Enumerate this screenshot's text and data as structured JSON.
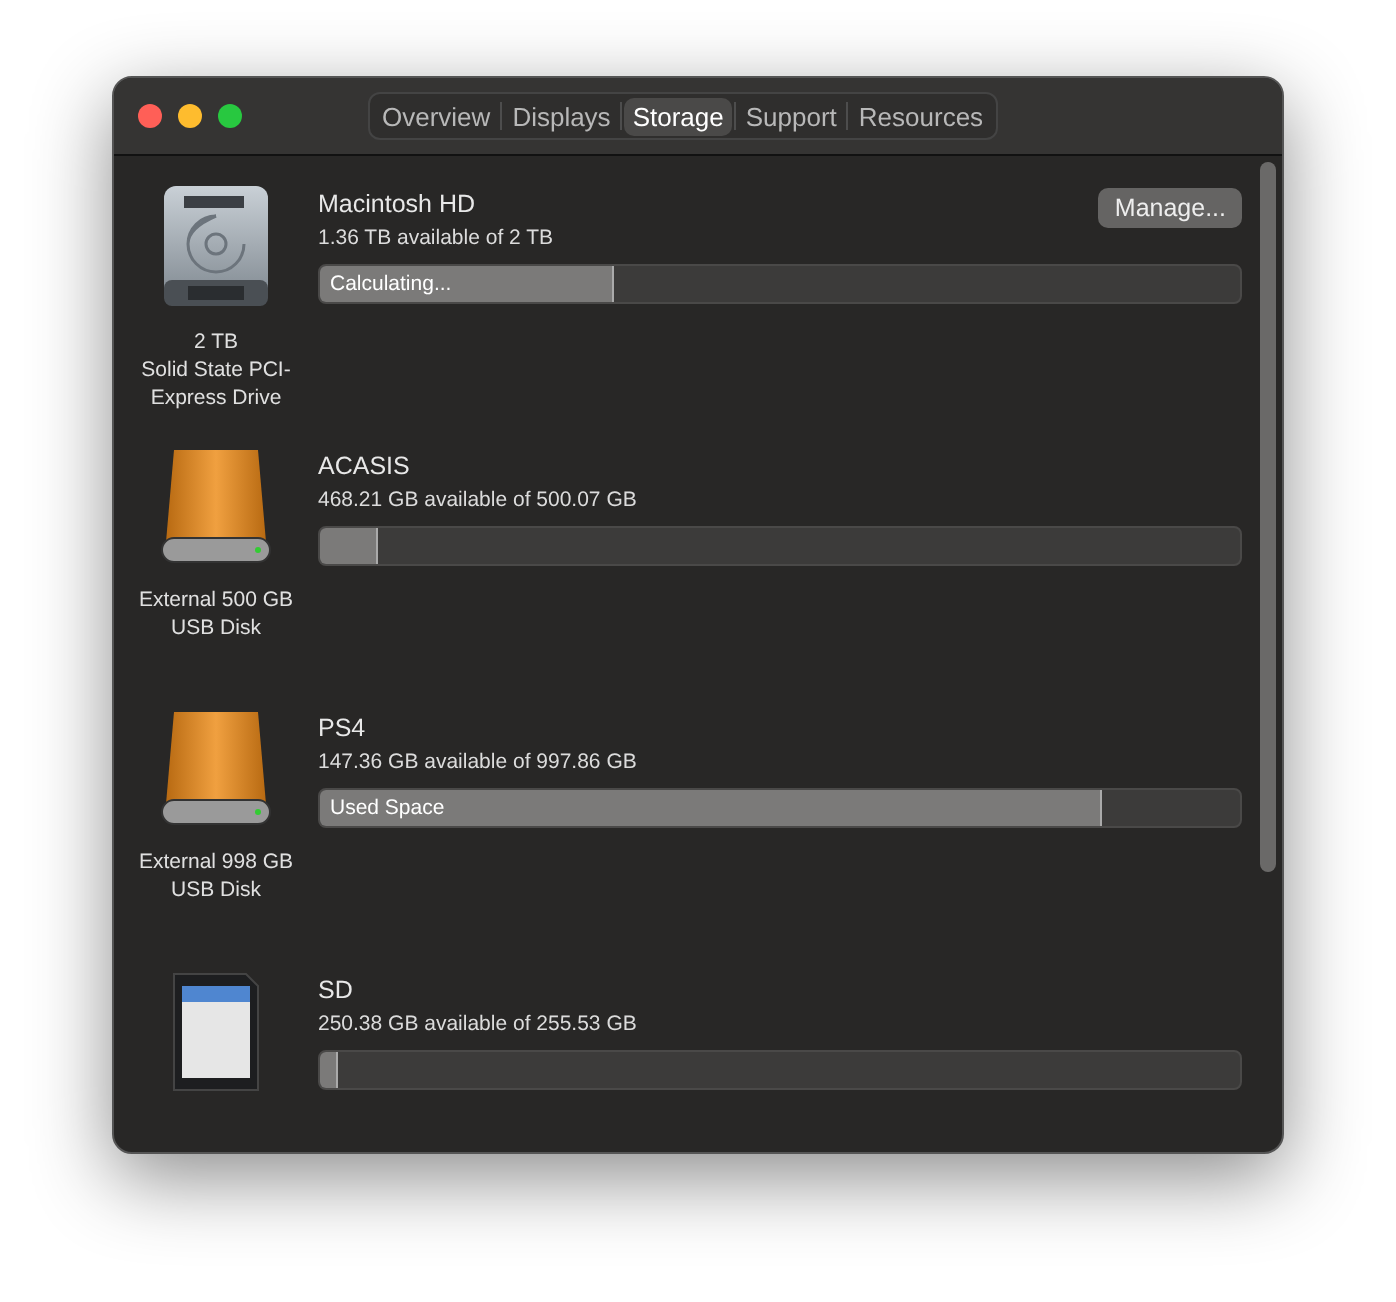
{
  "tabs": [
    {
      "label": "Overview",
      "selected": false
    },
    {
      "label": "Displays",
      "selected": false
    },
    {
      "label": "Storage",
      "selected": true
    },
    {
      "label": "Support",
      "selected": false
    },
    {
      "label": "Resources",
      "selected": false
    }
  ],
  "drives": [
    {
      "kind": "internal",
      "name": "Macintosh HD",
      "available": "1.36 TB available of 2 TB",
      "caption": [
        "2 TB",
        "Solid State PCI-",
        "Express Drive"
      ],
      "level": 0.32,
      "bar_label": "Calculating...",
      "button": "Manage..."
    },
    {
      "kind": "external",
      "name": "ACASIS",
      "available": "468.21 GB available of 500.07 GB",
      "caption": [
        "External 500 GB",
        "USB Disk"
      ],
      "level": 0.063
    },
    {
      "kind": "external",
      "name": "PS4",
      "available": "147.36 GB available of 997.86 GB",
      "caption": [
        "External 998 GB",
        "USB Disk"
      ],
      "level": 0.85,
      "bar_label": "Used Space"
    },
    {
      "kind": "sd",
      "name": "SD",
      "available": "250.38 GB available of 255.53 GB",
      "level": 0.02
    }
  ]
}
